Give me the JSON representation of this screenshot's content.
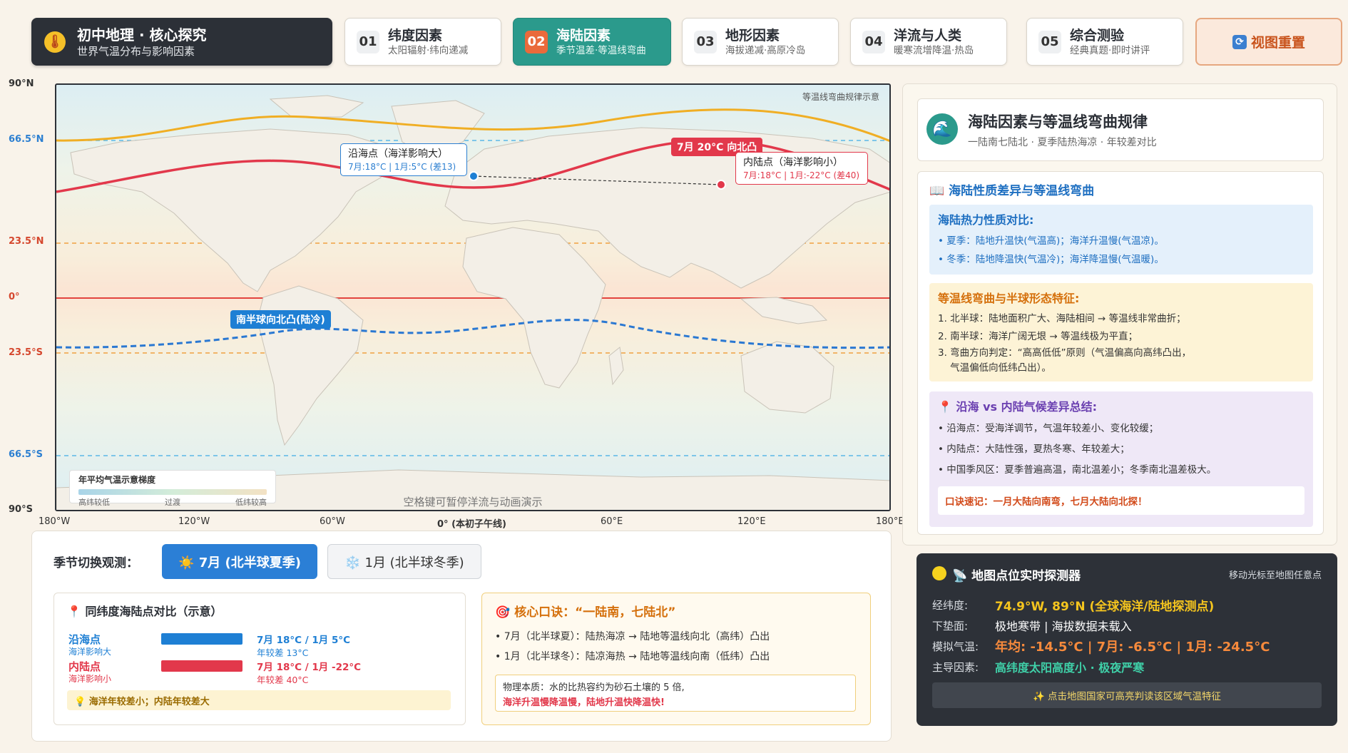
{
  "header": {
    "brand_title": "初中地理 · 核心探究",
    "brand_subtitle": "世界气温分布与影响因素",
    "tabs": [
      {
        "num": "01",
        "title": "纬度因素",
        "subtitle": "太阳辐射·纬向递减",
        "active": false
      },
      {
        "num": "02",
        "title": "海陆因素",
        "subtitle": "季节温差·等温线弯曲",
        "active": true
      },
      {
        "num": "03",
        "title": "地形因素",
        "subtitle": "海拔递减·高原冷岛",
        "active": false
      },
      {
        "num": "04",
        "title": "洋流与人类",
        "subtitle": "暖寒流增降温·热岛",
        "active": false
      },
      {
        "num": "05",
        "title": "综合测验",
        "subtitle": "经典真题·即时讲评",
        "active": false
      }
    ],
    "reset_label": "视图重置"
  },
  "map": {
    "caption": "等温线弯曲规律示意",
    "lat_labels": [
      "90°N",
      "66.5°N",
      "23.5°N",
      "0°",
      "23.5°S",
      "66.5°S",
      "90°S"
    ],
    "lon_labels": [
      "180°W",
      "120°W",
      "60°W",
      "0° (本初子午线)",
      "60°E",
      "120°E",
      "180°E"
    ],
    "coastal_callout": {
      "title": "沿海点（海洋影响大）",
      "detail": "7月:18°C | 1月:5°C (差13)"
    },
    "inland_callout": {
      "title": "内陆点（海洋影响小）",
      "detail": "7月:18°C | 1月:-22°C (差40)"
    },
    "north_tag": "7月 20°C 向北凸",
    "south_tag": "南半球向北凸(陆冷)",
    "legend_title": "年平均气温示意梯度",
    "legend_labels": [
      "高纬较低",
      "过渡",
      "低纬较高"
    ],
    "hint": "空格键可暂停洋流与动画演示",
    "colors": {
      "july_isotherm": "#e2384b",
      "south_isotherm": "#2a78d2",
      "arctic_line": "#f0ae24",
      "equator": "#e3443e",
      "tropic": "#f0a040",
      "polar_circle": "#5bb8e6"
    }
  },
  "season": {
    "label": "季节切换观测：",
    "july_btn": "☀️ 7月 (北半球夏季)",
    "jan_btn": "❄️ 1月 (北半球冬季)",
    "compare_title": "📍 同纬度海陆点对比（示意）",
    "coastal": {
      "name": "沿海点",
      "sub": "海洋影响大",
      "temps": "7月 18°C / 1月 5°C",
      "range": "年较差 13°C"
    },
    "inland": {
      "name": "内陆点",
      "sub": "海洋影响小",
      "temps": "7月 18°C / 1月 -22°C",
      "range": "年较差 40°C"
    },
    "compare_note": "💡 海洋年较差小；内陆年较差大",
    "mnemonic_title": "🎯 核心口诀：“一陆南，七陆北”",
    "mnemonic_lines": [
      "• 7月（北半球夏）：陆热海凉 → 陆地等温线向北（高纬）凸出",
      "• 1月（北半球冬）：陆凉海热 → 陆地等温线向南（低纬）凸出"
    ],
    "physics_line1": "物理本质：水的比热容约为砂石土壤的 5 倍,",
    "physics_line2": "海洋升温慢降温慢，陆地升温快降温快!"
  },
  "rules": {
    "title": "海陆因素与等温线弯曲规律",
    "subtitle": "一陆南七陆北 · 夏季陆热海凉 · 年较差对比",
    "section_title": "📖 海陆性质差异与等温线弯曲",
    "box1_title": "海陆热力性质对比:",
    "box1_lines": [
      "• 夏季：陆地升温快(气温高)；海洋升温慢(气温凉)。",
      "• 冬季：陆地降温快(气温冷)；海洋降温慢(气温暖)。"
    ],
    "box2_title": "等温线弯曲与半球形态特征:",
    "box2_lines": [
      "1. 北半球：陆地面积广大、海陆相间 → 等温线非常曲折；",
      "2. 南半球：海洋广阔无垠 → 等温线极为平直；",
      "3. 弯曲方向判定：“高高低低”原则（气温偏高向高纬凸出，",
      "    气温偏低向低纬凸出）。"
    ],
    "box3_title": "📍 沿海 vs 内陆气候差异总结:",
    "box3_lines": [
      "• 沿海点：受海洋调节，气温年较差小、变化较缓；",
      "• 内陆点：大陆性强，夏热冬寒、年较差大；",
      "• 中国季风区：夏季普遍高温，南北温差小；冬季南北温差极大。"
    ],
    "box3_tip": "口诀速记：一月大陆向南弯，七月大陆向北探！"
  },
  "probe": {
    "title": "📡 地图点位实时探测器",
    "hint": "移动光标至地图任意点",
    "rows": [
      {
        "key": "经纬度:",
        "value": "74.9°W, 89°N (全球海洋/陆地探测点)"
      },
      {
        "key": "下垫面:",
        "value": "极地寒带 | 海拔数据未载入"
      },
      {
        "key": "模拟气温:",
        "value": "年均: -14.5°C | 7月: -6.5°C | 1月: -24.5°C"
      },
      {
        "key": "主导因素:",
        "value": "高纬度太阳高度小 · 极夜严寒"
      }
    ],
    "footer_btn": "✨ 点击地图国家可高亮判读该区域气温特征"
  }
}
